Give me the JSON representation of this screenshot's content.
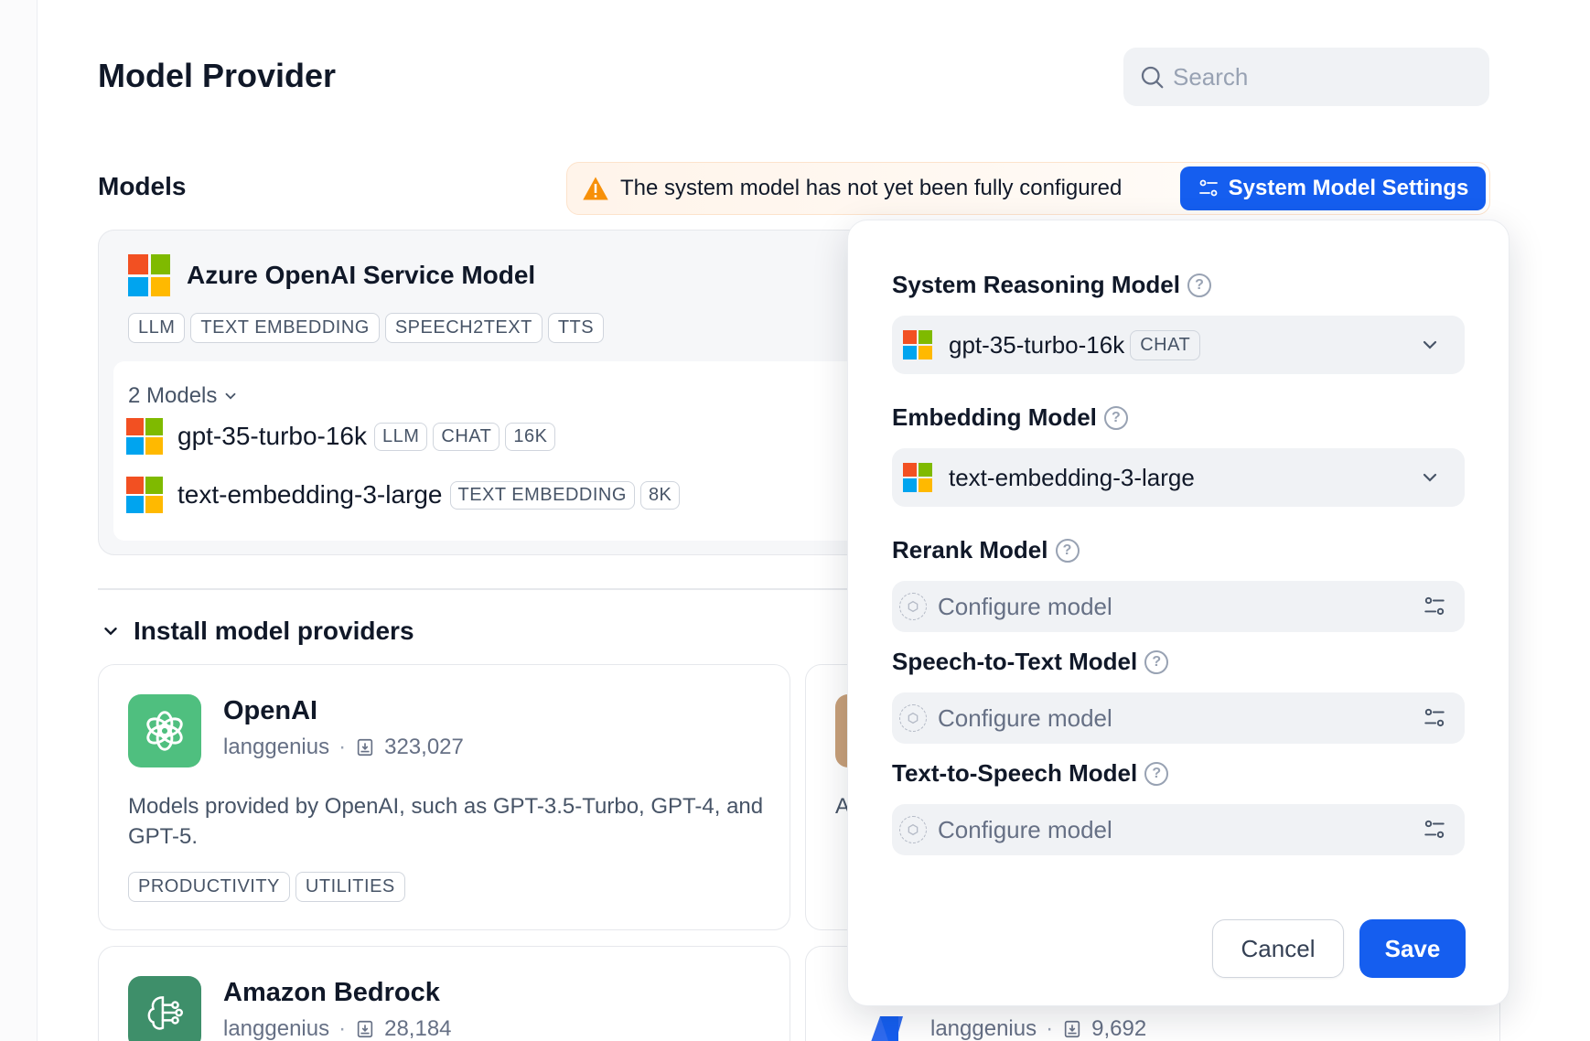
{
  "header": {
    "title": "Model Provider",
    "search_placeholder": "Search"
  },
  "models_section": {
    "title": "Models",
    "warning_text": "The system model has not yet been fully configured",
    "system_settings_label": "System Model Settings"
  },
  "azure": {
    "name": "Azure OpenAI Service Model",
    "tags": [
      "LLM",
      "TEXT EMBEDDING",
      "SPEECH2TEXT",
      "TTS"
    ],
    "models_toggle": "2 Models",
    "models": [
      {
        "name": "gpt-35-turbo-16k",
        "tags": [
          "LLM",
          "CHAT",
          "16K"
        ]
      },
      {
        "name": "text-embedding-3-large",
        "tags": [
          "TEXT EMBEDDING",
          "8K"
        ]
      }
    ]
  },
  "install": {
    "title": "Install model providers",
    "providers": [
      {
        "name": "OpenAI",
        "author": "langgenius",
        "downloads": "323,027",
        "description": "Models provided by OpenAI, such as GPT-3.5-Turbo, GPT-4, and GPT-5.",
        "tags": [
          "PRODUCTIVITY",
          "UTILITIES"
        ],
        "icon_color": "#4fbf7f"
      },
      {
        "name": "Amazon Bedrock",
        "author": "langgenius",
        "downloads": "28,184",
        "icon_color": "#3e8f6a"
      },
      {
        "desc_fragment": "A"
      },
      {
        "author": "langgenius",
        "downloads": "9,692"
      }
    ]
  },
  "system_model_panel": {
    "fields": [
      {
        "label": "System Reasoning Model",
        "value": "gpt-35-turbo-16k",
        "value_tag": "CHAT"
      },
      {
        "label": "Embedding Model",
        "value": "text-embedding-3-large"
      },
      {
        "label": "Rerank Model",
        "placeholder": "Configure model"
      },
      {
        "label": "Speech-to-Text Model",
        "placeholder": "Configure model"
      },
      {
        "label": "Text-to-Speech Model",
        "placeholder": "Configure model"
      }
    ],
    "help_glyph": "?",
    "cancel_label": "Cancel",
    "save_label": "Save"
  },
  "colors": {
    "primary": "#155eef",
    "warning": "#f79009",
    "ms_red": "#f25022",
    "ms_green": "#7fba00",
    "ms_blue": "#00a4ef",
    "ms_yellow": "#ffb900"
  }
}
